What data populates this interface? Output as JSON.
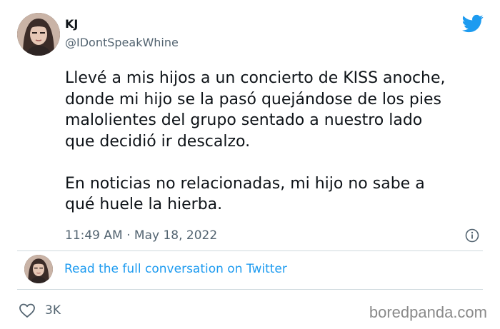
{
  "author": {
    "name": "KJ",
    "handle": "@IDontSpeakWhine",
    "avatar_icon": "profile-photo"
  },
  "platform_icon": "twitter-bird-icon",
  "tweet": {
    "text": "Llevé a mis hijos a un concierto de KISS anoche,\ndonde mi hijo se la pasó quejándose de los pies\nmalolientes del grupo sentado a nuestro lado\nque decidió ir descalzo.\n\nEn noticias no relacionadas, mi hijo no sabe a\nqué huele la hierba.",
    "timestamp": "11:49 AM · May 18, 2022"
  },
  "footer": {
    "read_link": "Read the full conversation on Twitter",
    "likes": "3K"
  },
  "watermark": "boredpanda.com",
  "colors": {
    "accent": "#1d9bf0",
    "secondary_text": "#536471",
    "divider": "#cfd9de"
  }
}
